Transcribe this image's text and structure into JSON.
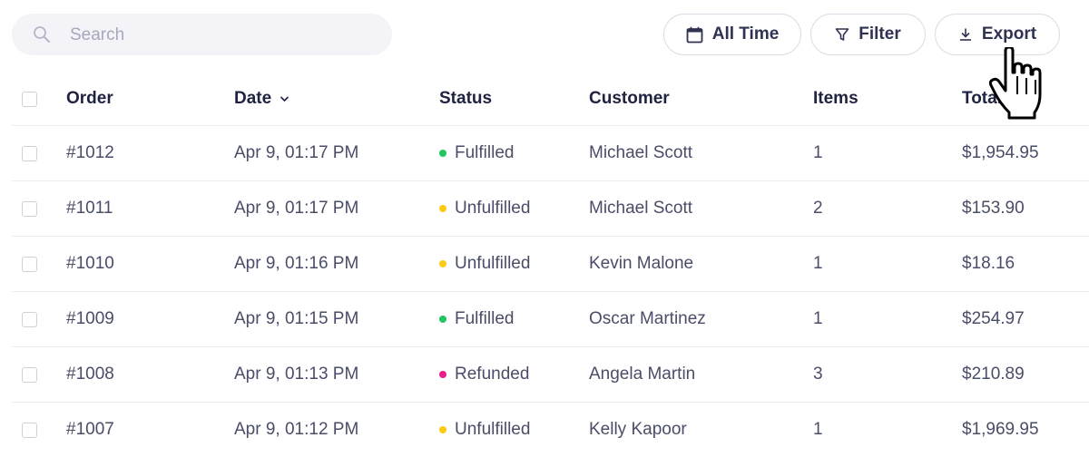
{
  "search": {
    "placeholder": "Search",
    "value": ""
  },
  "toolbar": {
    "all_time_label": "All Time",
    "filter_label": "Filter",
    "export_label": "Export"
  },
  "table": {
    "columns": {
      "order": "Order",
      "date": "Date",
      "status": "Status",
      "customer": "Customer",
      "items": "Items",
      "total": "Total"
    },
    "rows": [
      {
        "order": "#1012",
        "date": "Apr 9, 01:17 PM",
        "status": "Fulfilled",
        "customer": "Michael Scott",
        "items": "1",
        "total": "$1,954.95"
      },
      {
        "order": "#1011",
        "date": "Apr 9, 01:17 PM",
        "status": "Unfulfilled",
        "customer": "Michael Scott",
        "items": "2",
        "total": "$153.90"
      },
      {
        "order": "#1010",
        "date": "Apr 9, 01:16 PM",
        "status": "Unfulfilled",
        "customer": "Kevin Malone",
        "items": "1",
        "total": "$18.16"
      },
      {
        "order": "#1009",
        "date": "Apr 9, 01:15 PM",
        "status": "Fulfilled",
        "customer": "Oscar Martinez",
        "items": "1",
        "total": "$254.97"
      },
      {
        "order": "#1008",
        "date": "Apr 9, 01:13 PM",
        "status": "Refunded",
        "customer": "Angela Martin",
        "items": "3",
        "total": "$210.89"
      },
      {
        "order": "#1007",
        "date": "Apr 9, 01:12 PM",
        "status": "Unfulfilled",
        "customer": "Kelly Kapoor",
        "items": "1",
        "total": "$1,969.95"
      }
    ]
  },
  "status_colors": {
    "Fulfilled": "#22c55e",
    "Unfulfilled": "#facc15",
    "Refunded": "#ec1a8a"
  },
  "icons": {
    "search": "search-icon",
    "calendar": "calendar-icon",
    "filter": "filter-icon",
    "export": "download-icon",
    "sort": "chevron-down-icon",
    "cursor": "hand-pointer-cursor"
  }
}
